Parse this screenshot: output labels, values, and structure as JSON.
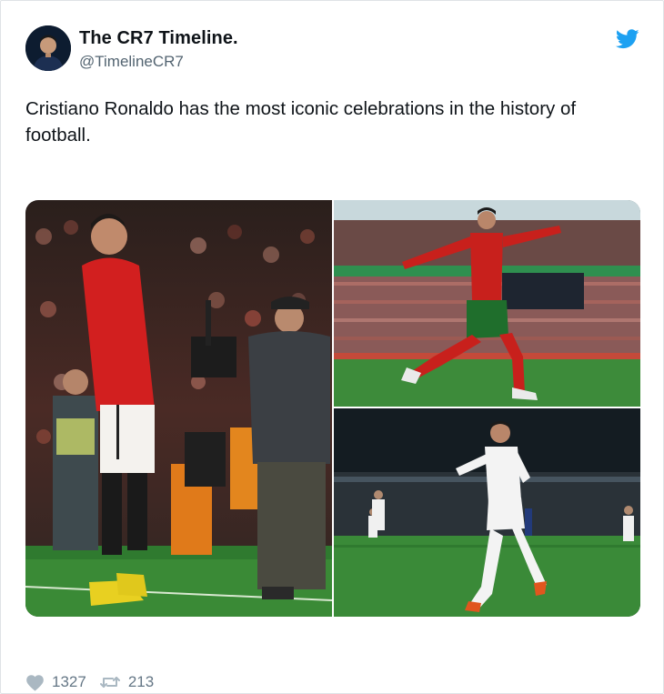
{
  "account": {
    "display_name": "The CR7 Timeline.",
    "handle": "@TimelineCR7"
  },
  "icons": {
    "platform": "twitter-bird-icon",
    "like": "heart-icon",
    "retweet": "retweet-icon"
  },
  "tweet": {
    "text": "Cristiano Ronaldo has the most iconic celebrations in the history of football."
  },
  "media": {
    "photo_count": 3
  },
  "stats": {
    "likes": "1327",
    "retweets": "213"
  },
  "colors": {
    "twitter_blue": "#1da1f2",
    "text_primary": "#0f1419",
    "text_secondary": "#536471",
    "icon_grey": "#aab8c2"
  }
}
